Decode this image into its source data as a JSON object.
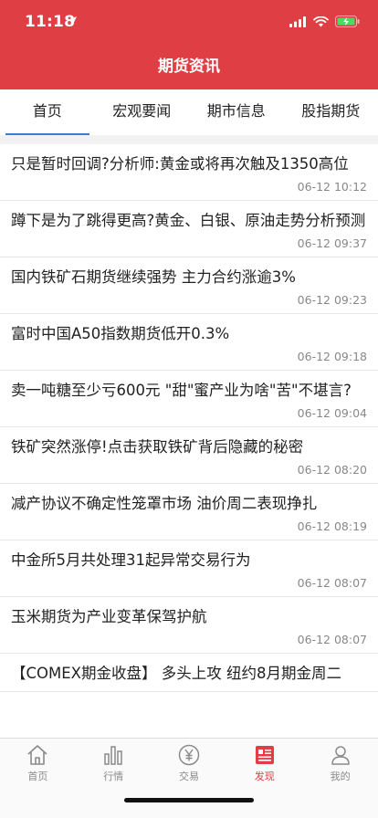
{
  "status_bar": {
    "time": "11:18"
  },
  "nav": {
    "title": "期货资讯"
  },
  "tabs": [
    {
      "label": "首页",
      "active": true
    },
    {
      "label": "宏观要闻",
      "active": false
    },
    {
      "label": "期市信息",
      "active": false
    },
    {
      "label": "股指期货",
      "active": false
    }
  ],
  "news": [
    {
      "title": "只是暂时回调?分析师:黄金或将再次触及1350高位",
      "time": "06-12 10:12"
    },
    {
      "title": "蹲下是为了跳得更高?黄金、白银、原油走势分析预测",
      "time": "06-12 09:37"
    },
    {
      "title": "国内铁矿石期货继续强势 主力合约涨逾3%",
      "time": "06-12 09:23"
    },
    {
      "title": "富时中国A50指数期货低开0.3%",
      "time": "06-12 09:18"
    },
    {
      "title": "卖一吨糖至少亏600元 \"甜\"蜜产业为啥\"苦\"不堪言?",
      "time": "06-12 09:04"
    },
    {
      "title": "铁矿突然涨停!点击获取铁矿背后隐藏的秘密",
      "time": "06-12 08:20"
    },
    {
      "title": "减产协议不确定性笼罩市场 油价周二表现挣扎",
      "time": "06-12 08:19"
    },
    {
      "title": "中金所5月共处理31起异常交易行为",
      "time": "06-12 08:07"
    },
    {
      "title": "玉米期货为产业变革保驾护航",
      "time": "06-12 08:07"
    },
    {
      "title": "【COMEX期金收盘】 多头上攻 纽约8月期金周二",
      "time": ""
    }
  ],
  "tabbar": [
    {
      "label": "首页",
      "icon": "home-icon"
    },
    {
      "label": "行情",
      "icon": "chart-bars-icon"
    },
    {
      "label": "交易",
      "icon": "yen-coin-icon"
    },
    {
      "label": "发现",
      "icon": "news-doc-icon",
      "active": true
    },
    {
      "label": "我的",
      "icon": "user-icon"
    }
  ],
  "colors": {
    "header_red": "#df3e45",
    "tab_underline": "#3a7bd5",
    "active_tab_red": "#df3e45"
  }
}
